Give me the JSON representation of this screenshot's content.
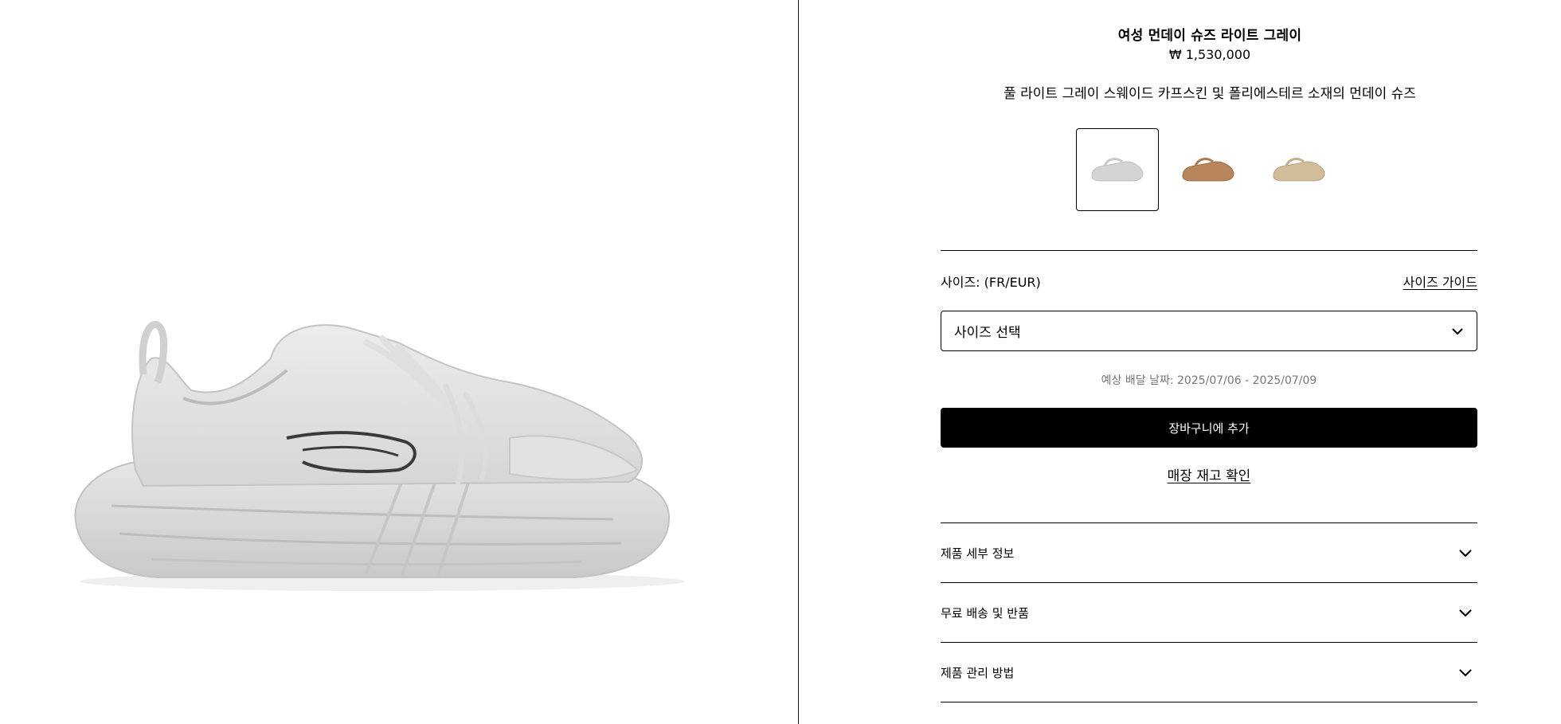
{
  "product": {
    "title": "여성 먼데이 슈즈 라이트 그레이",
    "price": "₩ 1,530,000",
    "description": "풀 라이트 그레이 스웨이드 카프스킨 및 폴리에스테르 소재의 먼데이 슈즈"
  },
  "swatches": [
    {
      "name": "light-grey",
      "color": "#d9d9d9",
      "selected": true
    },
    {
      "name": "brown",
      "color": "#b8865a",
      "selected": false
    },
    {
      "name": "beige",
      "color": "#d2bd9b",
      "selected": false
    }
  ],
  "size": {
    "label": "사이즈: (FR/EUR)",
    "guide_link": "사이즈 가이드",
    "select_placeholder": "사이즈 선택"
  },
  "delivery": "예상 배달 날짜: 2025/07/06 - 2025/07/09",
  "actions": {
    "add_to_cart": "장바구니에 추가",
    "check_stock": "매장 재고 확인"
  },
  "accordion": [
    {
      "label": "제품 세부 정보"
    },
    {
      "label": "무료 배송 및 반품"
    },
    {
      "label": "제품 관리 방법"
    }
  ],
  "icons": {
    "select": "chevron-down-icon",
    "accordion": "chevron-down-icon"
  }
}
